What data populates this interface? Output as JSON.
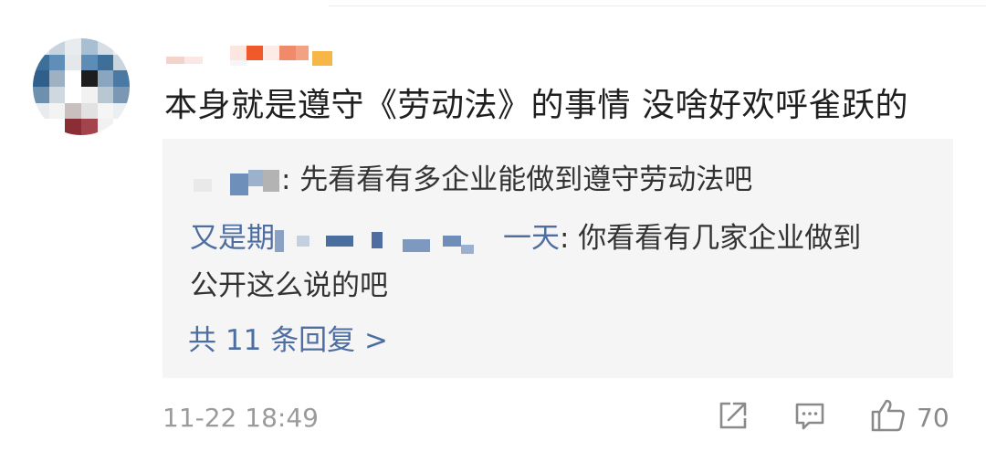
{
  "comment": {
    "text": "本身就是遵守《劳动法》的事情 没啥好欢呼雀跃的",
    "time": "11-22 18:49",
    "like_count": "70"
  },
  "replies": [
    {
      "name_visible": "",
      "name_end": "‧",
      "text": ": 先看看有多企业能做到遵守劳动法吧"
    },
    {
      "name_start": "又是期",
      "name_end": "一天",
      "text": ": 你看看有几家企业做到",
      "text_cont": "公开这么说的吧"
    }
  ],
  "more_replies": "共 11 条回复 >",
  "icons": {
    "share": "share-icon",
    "comment": "comment-icon",
    "like": "thumbs-up-icon"
  },
  "colors": {
    "link": "#4e6ea1",
    "reply_bg": "#f5f5f5",
    "meta": "#9b9b9b"
  }
}
